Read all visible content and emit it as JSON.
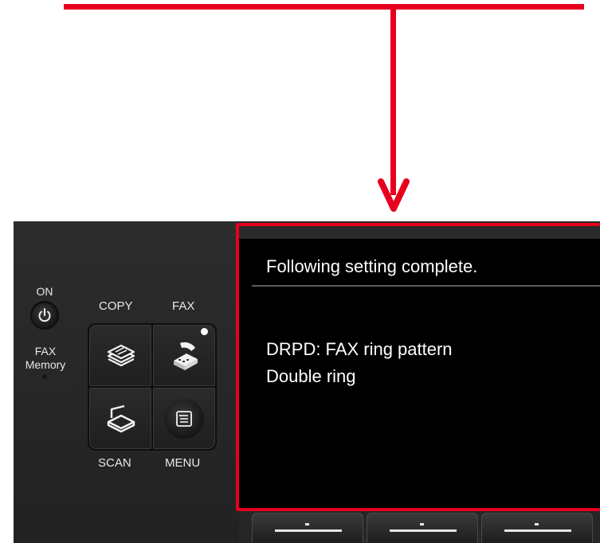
{
  "annotation": {
    "color": "#e6001e"
  },
  "panel": {
    "power": {
      "label": "ON",
      "icon": "power-icon"
    },
    "fax_memory": {
      "label_line1": "FAX",
      "label_line2": "Memory"
    },
    "buttons": {
      "copy_label": "COPY",
      "fax_label": "FAX",
      "scan_label": "SCAN",
      "menu_label": "MENU"
    }
  },
  "lcd": {
    "title": "Following setting complete.",
    "line1": "DRPD: FAX ring pattern",
    "line2": "Double ring"
  }
}
